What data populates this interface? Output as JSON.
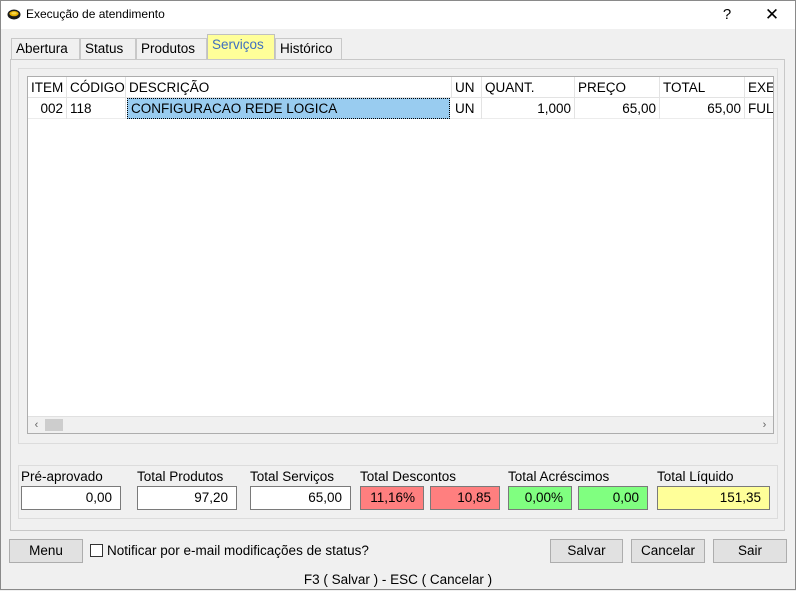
{
  "window": {
    "title": "Execução de atendimento",
    "help_symbol": "?",
    "close_symbol": "✕",
    "icon": "app-coin-icon"
  },
  "tabs": [
    {
      "label": "Abertura",
      "active": false
    },
    {
      "label": "Status",
      "active": false
    },
    {
      "label": "Produtos",
      "active": false
    },
    {
      "label": "Serviços",
      "active": true
    },
    {
      "label": "Histórico",
      "active": false
    }
  ],
  "grid": {
    "columns": [
      "ITEM",
      "CÓDIGO",
      "DESCRIÇÃO",
      "UN",
      "QUANT.",
      "PREÇO",
      "TOTAL",
      "EXE"
    ],
    "rows": [
      {
        "item": "002",
        "codigo": "118",
        "descricao": "CONFIGURACAO REDE LOGICA",
        "un": "UN",
        "quant": "1,000",
        "preco": "65,00",
        "total": "65,00",
        "exe": "FUL"
      }
    ],
    "scroll_left": "‹",
    "scroll_right": "›"
  },
  "totals": {
    "pre_aprovado": {
      "label": "Pré-aprovado",
      "value": "0,00"
    },
    "total_produtos": {
      "label": "Total Produtos",
      "value": "97,20"
    },
    "total_servicos": {
      "label": "Total Serviços",
      "value": "65,00"
    },
    "total_descontos": {
      "label": "Total Descontos",
      "percent": "11,16%",
      "value": "10,85"
    },
    "total_acrescimos": {
      "label": "Total Acréscimos",
      "percent": "0,00%",
      "value": "0,00"
    },
    "total_liquido": {
      "label": "Total Líquido",
      "value": "151,35"
    }
  },
  "colors": {
    "active_tab_bg": "#ffff99",
    "active_tab_text": "#3f6fc0",
    "selection": "#99ccf0",
    "discount_bg": "#ff7f7f",
    "surcharge_bg": "#80ff80",
    "net_total_bg": "#ffff99"
  },
  "actions": {
    "menu": "Menu",
    "notify_label": "Notificar por e-mail modificações de status?",
    "notify_checked": false,
    "save": "Salvar",
    "cancel": "Cancelar",
    "exit": "Sair"
  },
  "status_bar": "F3 ( Salvar )  -  ESC ( Cancelar )"
}
